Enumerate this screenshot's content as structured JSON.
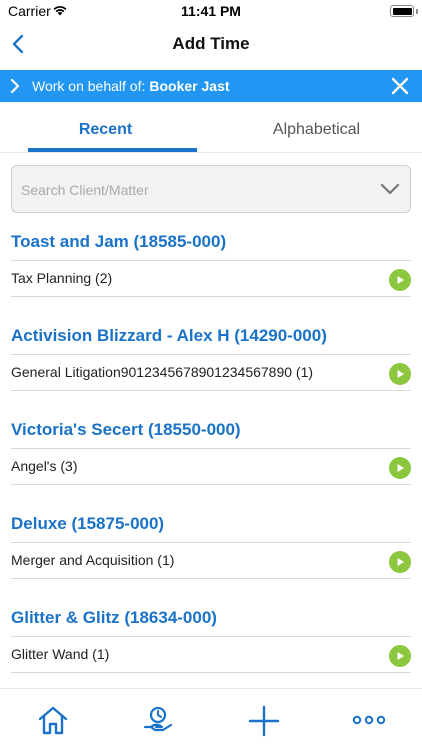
{
  "status_bar": {
    "carrier": "Carrier",
    "time": "11:41 PM",
    "wifi_icon": "wifi-icon",
    "battery_icon": "battery-icon"
  },
  "nav": {
    "title": "Add Time",
    "back_icon": "chevron-left-icon"
  },
  "behalf": {
    "label": "Work on behalf of:",
    "name": "Booker Jast",
    "background": "#2196f3"
  },
  "tabs": [
    {
      "label": "Recent",
      "active": true
    },
    {
      "label": "Alphabetical",
      "active": false
    }
  ],
  "search": {
    "placeholder": "Search Client/Matter"
  },
  "clients": [
    {
      "title": "Toast and Jam (18585-000)",
      "matter": "Tax Planning (2)"
    },
    {
      "title": "Activision Blizzard - Alex H (14290-000)",
      "matter": "General Litigation9012345678901234567890 (1)"
    },
    {
      "title": "Victoria's Secert (18550-000)",
      "matter": "Angel's (3)"
    },
    {
      "title": "Deluxe (15875-000)",
      "matter": "Merger and Acquisition (1)"
    },
    {
      "title": "Glitter & Glitz (18634-000)",
      "matter": "Glitter Wand (1)"
    }
  ],
  "tab_bar": [
    {
      "icon": "home-icon"
    },
    {
      "icon": "time-money-icon"
    },
    {
      "icon": "plus-icon"
    },
    {
      "icon": "more-icon"
    }
  ],
  "colors": {
    "accent": "#1a73c8",
    "play": "#8dc63f"
  }
}
